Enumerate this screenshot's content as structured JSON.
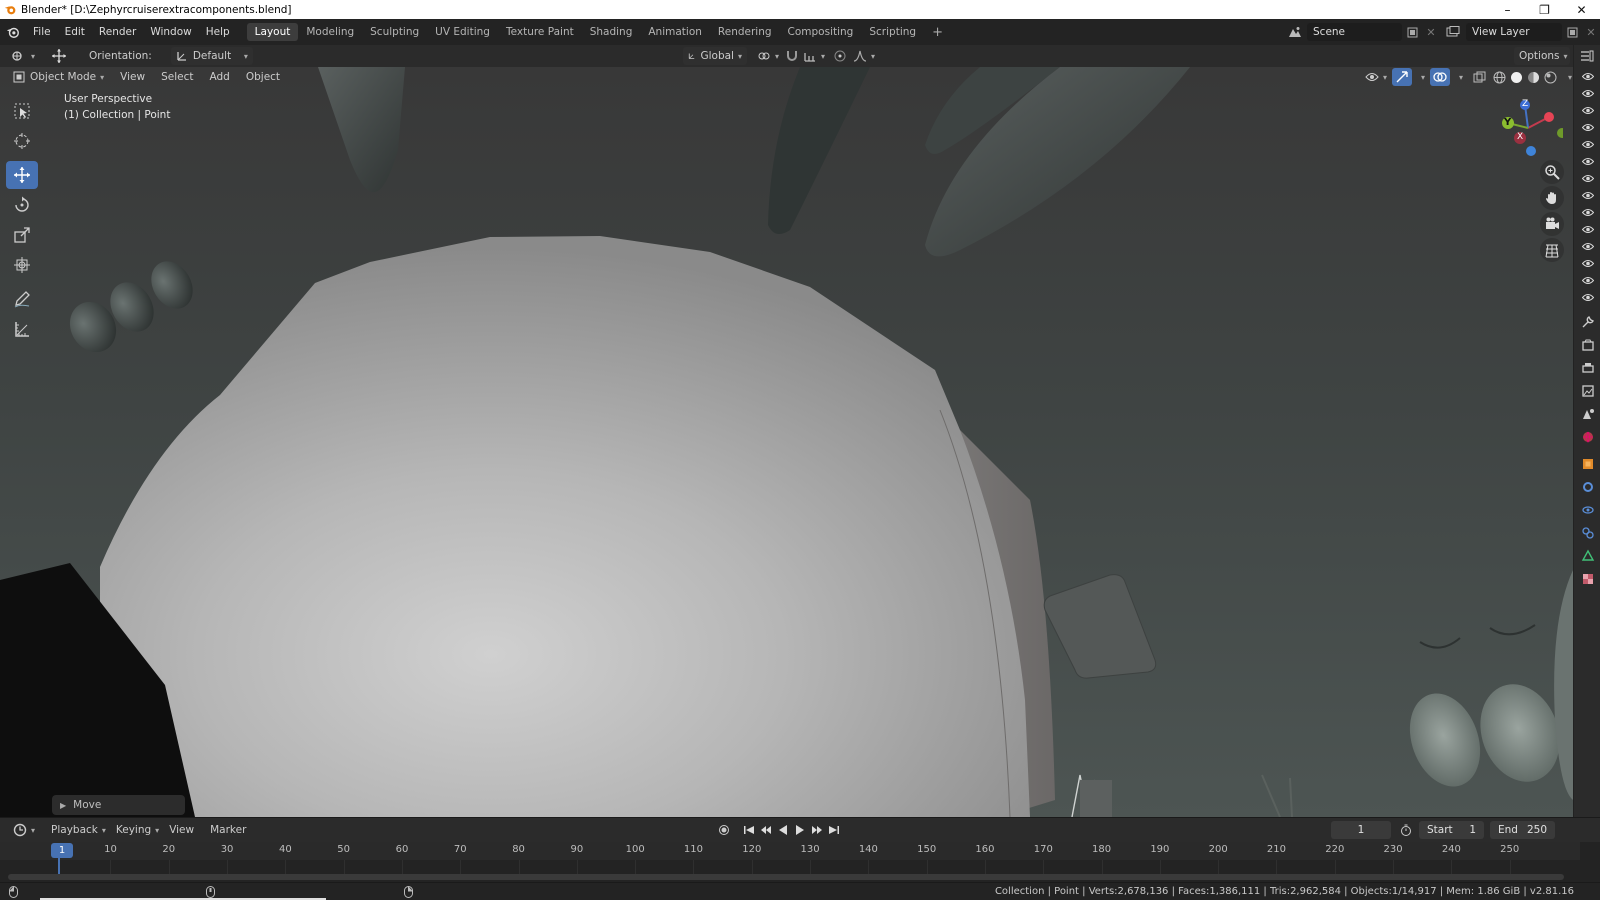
{
  "window": {
    "title": "Blender* [D:\\Zephyrcruiserextracomponents.blend]",
    "minimize": "–",
    "restore": "❐",
    "close": "✕"
  },
  "menu": [
    "File",
    "Edit",
    "Render",
    "Window",
    "Help"
  ],
  "workspaces": [
    "Layout",
    "Modeling",
    "Sculpting",
    "UV Editing",
    "Texture Paint",
    "Shading",
    "Animation",
    "Rendering",
    "Compositing",
    "Scripting"
  ],
  "active_workspace": "Layout",
  "scene": {
    "name": "Scene",
    "view_layer": "View Layer"
  },
  "header3d": {
    "orientation_label": "Orientation:",
    "orientation_value": "Default",
    "transform_orientation": "Global",
    "options": "Options"
  },
  "header2": {
    "mode": "Object Mode",
    "view": "View",
    "select": "Select",
    "add": "Add",
    "object": "Object"
  },
  "viewport": {
    "perspective": "User Perspective",
    "collection": "(1) Collection | Point"
  },
  "gizmo": {
    "z": "Z",
    "y": "Y",
    "x": "X"
  },
  "last_op": "Move",
  "timeline": {
    "playback": "Playback",
    "keying": "Keying",
    "view": "View",
    "marker": "Marker",
    "current_frame": "1",
    "start_label": "Start",
    "start": "1",
    "end_label": "End",
    "end": "250",
    "ticks": [
      "10",
      "20",
      "30",
      "40",
      "50",
      "60",
      "70",
      "80",
      "90",
      "100",
      "110",
      "120",
      "130",
      "140",
      "150",
      "160",
      "170",
      "180",
      "190",
      "200",
      "210",
      "220",
      "230",
      "240",
      "250"
    ],
    "playhead": "1"
  },
  "status": "Collection | Point | Verts:2,678,136 | Faces:1,386,111 | Tris:2,962,584 | Objects:1/14,917 | Mem: 1.86 GiB | v2.81.16"
}
